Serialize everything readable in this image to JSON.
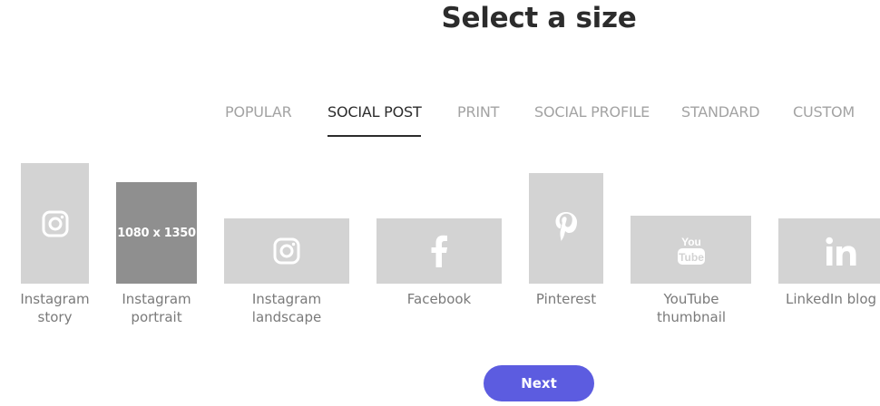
{
  "title": "Select a size",
  "tabs": [
    {
      "label": "POPULAR"
    },
    {
      "label": "SOCIAL POST"
    },
    {
      "label": "PRINT"
    },
    {
      "label": "SOCIAL PROFILE"
    },
    {
      "label": "STANDARD"
    },
    {
      "label": "CUSTOM"
    }
  ],
  "active_tab": "SOCIAL POST",
  "sizes": [
    {
      "label_line1": "Instagram",
      "label_line2": "story",
      "icon": "instagram-icon"
    },
    {
      "label_line1": "Instagram",
      "label_line2": "portrait",
      "thumb_text": "1080 x 1350",
      "selected": true
    },
    {
      "label_line1": "Instagram",
      "label_line2": "landscape",
      "icon": "instagram-icon"
    },
    {
      "label_line1": "Facebook",
      "label_line2": "",
      "icon": "facebook-icon"
    },
    {
      "label_line1": "Pinterest",
      "label_line2": "",
      "icon": "pinterest-icon"
    },
    {
      "label_line1": "YouTube",
      "label_line2": "thumbnail",
      "icon": "youtube-icon"
    },
    {
      "label_line1": "LinkedIn blog po",
      "label_line2": "",
      "icon": "linkedin-icon"
    }
  ],
  "next_label": "Next",
  "colors": {
    "accent": "#5c5ce0",
    "thumb": "#d3d3d3",
    "thumb_selected": "#8f8f8f",
    "tab_active": "#2c2c2c",
    "tab_inactive": "#a3a3a3"
  }
}
